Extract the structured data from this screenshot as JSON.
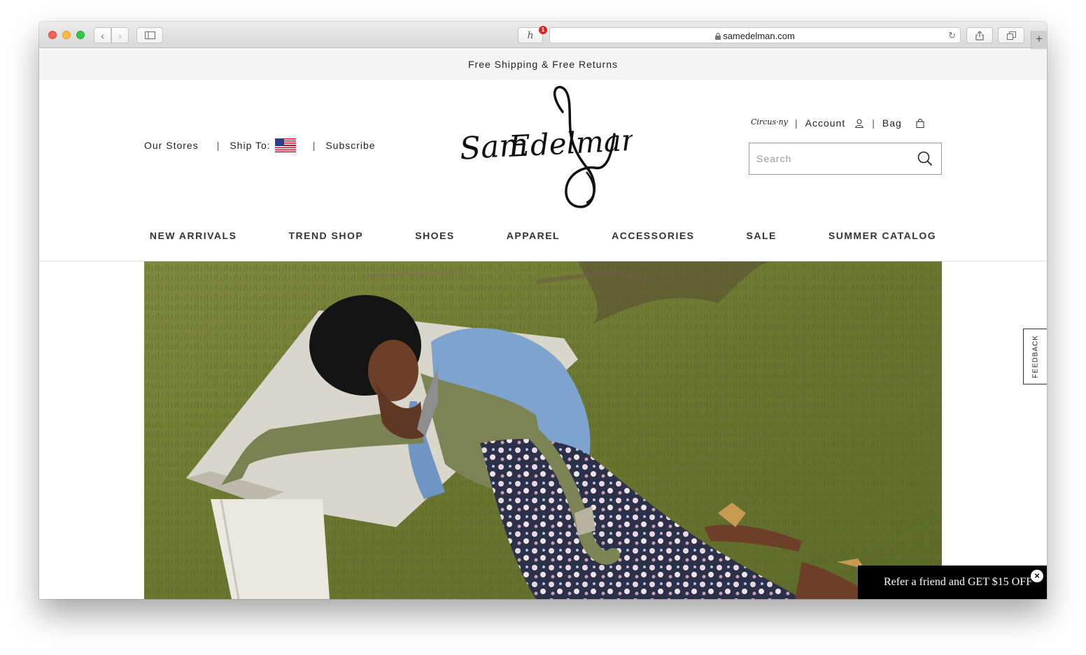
{
  "browser": {
    "url": "samedelman.com",
    "extension_badge": "1",
    "icons": {
      "back": "chevron-left-icon",
      "forward": "chevron-right-icon",
      "sidebar": "sidebar-icon",
      "extension": "honey-extension-icon",
      "lock": "lock-icon",
      "reload": "reload-icon",
      "share": "share-icon",
      "tabs": "tabs-icon",
      "new_tab": "plus-icon"
    }
  },
  "promo": {
    "text": "Free Shipping & Free Returns"
  },
  "header": {
    "our_stores": "Our Stores",
    "ship_to": "Ship To:",
    "subscribe": "Subscribe",
    "circus_logo": "Circus·ny",
    "account": "Account",
    "bag": "Bag",
    "brand_logo_text": "Sam Edelman",
    "search_placeholder": "Search"
  },
  "nav": {
    "items": [
      "NEW ARRIVALS",
      "TREND SHOP",
      "SHOES",
      "APPAREL",
      "ACCESSORIES",
      "SALE",
      "SUMMER CATALOG"
    ]
  },
  "feedback": {
    "label": "FEEDBACK"
  },
  "refer": {
    "text": "Refer a friend and GET $15 OFF",
    "close": "×"
  },
  "colors": {
    "promo_bg": "#f4f4f4",
    "text": "#222222",
    "refer_bg": "#000000",
    "grass": "#6d7a31",
    "denim": "#7ea3cf"
  }
}
